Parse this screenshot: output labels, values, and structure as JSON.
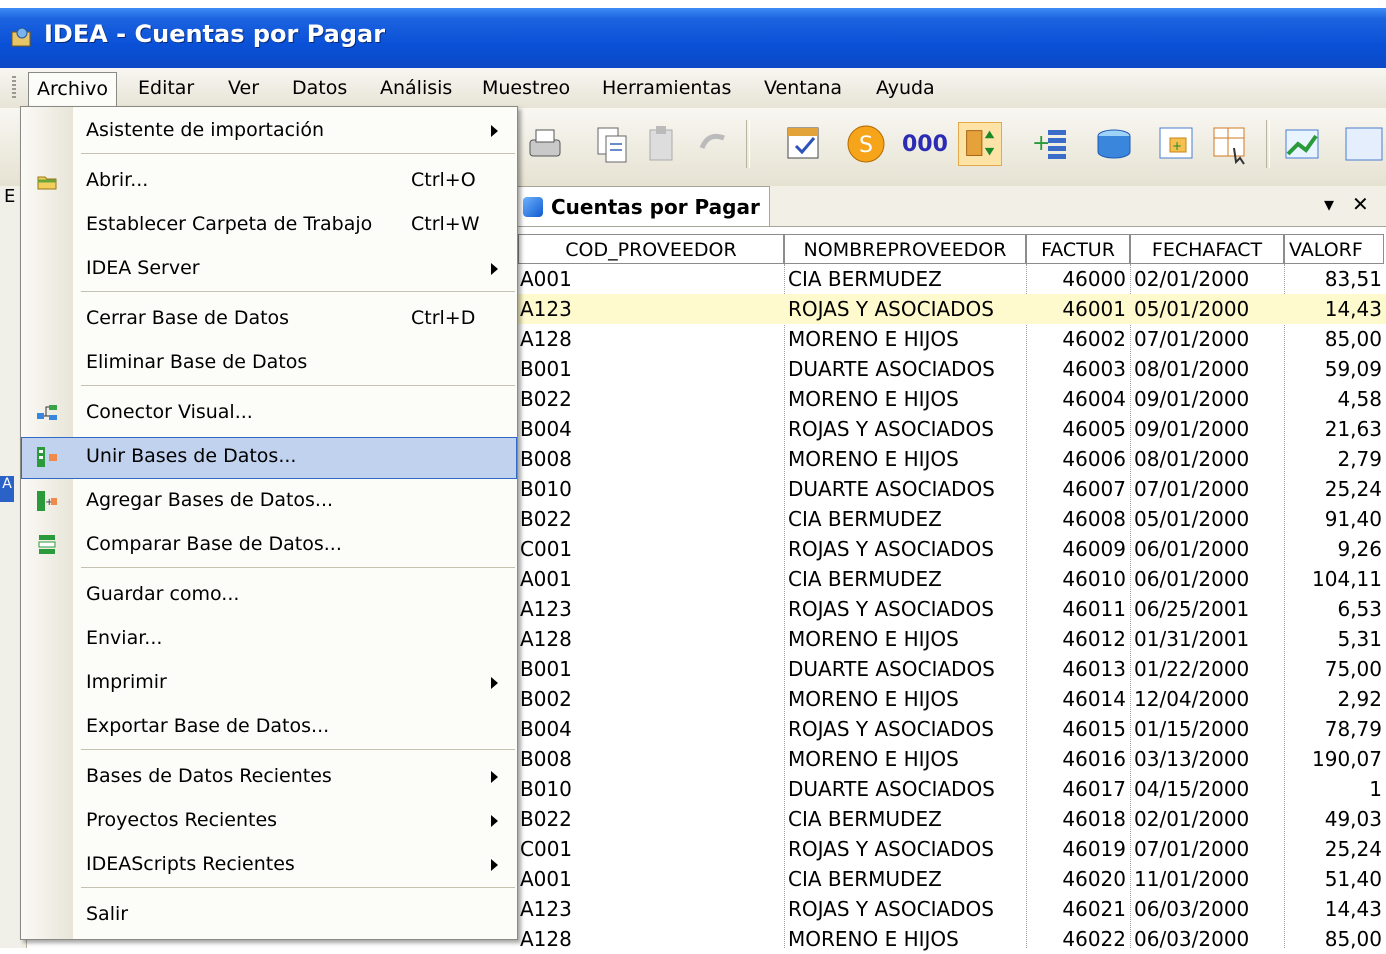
{
  "window": {
    "title": "IDEA - Cuentas por Pagar"
  },
  "menubar": [
    "Archivo",
    "Editar",
    "Ver",
    "Datos",
    "Análisis",
    "Muestreo",
    "Herramientas",
    "Ventana",
    "Ayuda"
  ],
  "toolbar": {
    "count_label": "000"
  },
  "left_pane": {
    "label_e": "E",
    "label_a": "A"
  },
  "document": {
    "tab_title": "Cuentas por Pagar",
    "pin": "▾",
    "close": "✕"
  },
  "grid": {
    "columns": [
      "COD_PROVEEDOR",
      "NOMBREPROVEEDOR",
      "FACTUR",
      "FECHAFACT",
      "VALORF"
    ],
    "rows": [
      [
        "A001",
        "CIA BERMUDEZ",
        "46000",
        "02/01/2000",
        "83,51"
      ],
      [
        "A123",
        "ROJAS Y ASOCIADOS",
        "46001",
        "05/01/2000",
        "14,43"
      ],
      [
        "A128",
        "MORENO E HIJOS",
        "46002",
        "07/01/2000",
        "85,00"
      ],
      [
        "B001",
        "DUARTE ASOCIADOS",
        "46003",
        "08/01/2000",
        "59,09"
      ],
      [
        "B022",
        "MORENO E HIJOS",
        "46004",
        "09/01/2000",
        "4,58"
      ],
      [
        "B004",
        "ROJAS Y ASOCIADOS",
        "46005",
        "09/01/2000",
        "21,63"
      ],
      [
        "B008",
        "MORENO E HIJOS",
        "46006",
        "08/01/2000",
        "2,79"
      ],
      [
        "B010",
        "DUARTE ASOCIADOS",
        "46007",
        "07/01/2000",
        "25,24"
      ],
      [
        "B022",
        "CIA BERMUDEZ",
        "46008",
        "05/01/2000",
        "91,40"
      ],
      [
        "C001",
        "ROJAS Y ASOCIADOS",
        "46009",
        "06/01/2000",
        "9,26"
      ],
      [
        "A001",
        "CIA BERMUDEZ",
        "46010",
        "06/01/2000",
        "104,11"
      ],
      [
        "A123",
        "ROJAS Y ASOCIADOS",
        "46011",
        "06/25/2001",
        "6,53"
      ],
      [
        "A128",
        "MORENO E HIJOS",
        "46012",
        "01/31/2001",
        "5,31"
      ],
      [
        "B001",
        "DUARTE ASOCIADOS",
        "46013",
        "01/22/2000",
        "75,00"
      ],
      [
        "B002",
        "MORENO E HIJOS",
        "46014",
        "12/04/2000",
        "2,92"
      ],
      [
        "B004",
        "ROJAS Y ASOCIADOS",
        "46015",
        "01/15/2000",
        "78,79"
      ],
      [
        "B008",
        "MORENO E HIJOS",
        "46016",
        "03/13/2000",
        "190,07"
      ],
      [
        "B010",
        "DUARTE ASOCIADOS",
        "46017",
        "04/15/2000",
        "1"
      ],
      [
        "B022",
        "CIA BERMUDEZ",
        "46018",
        "02/01/2000",
        "49,03"
      ],
      [
        "C001",
        "ROJAS Y ASOCIADOS",
        "46019",
        "07/01/2000",
        "25,24"
      ],
      [
        "A001",
        "CIA BERMUDEZ",
        "46020",
        "11/01/2000",
        "51,40"
      ],
      [
        "A123",
        "ROJAS Y ASOCIADOS",
        "46021",
        "06/03/2000",
        "14,43"
      ],
      [
        "A128",
        "MORENO E HIJOS",
        "46022",
        "06/03/2000",
        "85,00"
      ]
    ],
    "highlighted_row": 1
  },
  "file_menu": {
    "items": [
      {
        "label": "Asistente de importación",
        "shortcut": "",
        "submenu": true,
        "icon": ""
      },
      {
        "label": "Abrir...",
        "shortcut": "Ctrl+O",
        "submenu": false,
        "icon": "open-folder-icon"
      },
      {
        "label": "Establecer Carpeta de Trabajo",
        "shortcut": "Ctrl+W",
        "submenu": false,
        "icon": ""
      },
      {
        "label": "IDEA Server",
        "shortcut": "",
        "submenu": true,
        "icon": ""
      },
      {
        "label": "Cerrar Base de Datos",
        "shortcut": "Ctrl+D",
        "submenu": false,
        "icon": ""
      },
      {
        "label": "Eliminar Base de Datos",
        "shortcut": "",
        "submenu": false,
        "icon": ""
      },
      {
        "label": "Conector Visual...",
        "shortcut": "",
        "submenu": false,
        "icon": "visual-connector-icon"
      },
      {
        "label": "Unir Bases de Datos...",
        "shortcut": "",
        "submenu": false,
        "icon": "join-databases-icon"
      },
      {
        "label": "Agregar Bases de Datos...",
        "shortcut": "",
        "submenu": false,
        "icon": "append-databases-icon"
      },
      {
        "label": "Comparar Base de Datos...",
        "shortcut": "",
        "submenu": false,
        "icon": "compare-databases-icon"
      },
      {
        "label": "Guardar como...",
        "shortcut": "",
        "submenu": false,
        "icon": ""
      },
      {
        "label": "Enviar...",
        "shortcut": "",
        "submenu": false,
        "icon": ""
      },
      {
        "label": "Imprimir",
        "shortcut": "",
        "submenu": true,
        "icon": ""
      },
      {
        "label": "Exportar Base de Datos...",
        "shortcut": "",
        "submenu": false,
        "icon": ""
      },
      {
        "label": "Bases de Datos Recientes",
        "shortcut": "",
        "submenu": true,
        "icon": ""
      },
      {
        "label": "Proyectos Recientes",
        "shortcut": "",
        "submenu": true,
        "icon": ""
      },
      {
        "label": "IDEAScripts Recientes",
        "shortcut": "",
        "submenu": true,
        "icon": ""
      },
      {
        "label": "Salir",
        "shortcut": "",
        "submenu": false,
        "icon": ""
      }
    ],
    "hovered_item": "Unir Bases de Datos..."
  },
  "colors": {
    "title_bar": "#0a51d8",
    "highlight_row": "#fffacd",
    "menu_hover": "#c1d2ee"
  }
}
